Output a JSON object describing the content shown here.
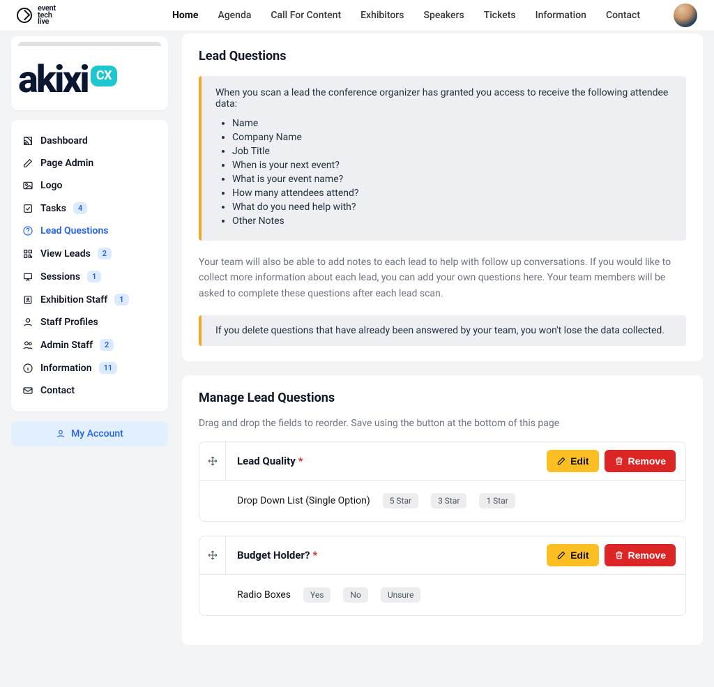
{
  "brand": {
    "l1": "event",
    "l2": "tech",
    "l3": "live"
  },
  "topnav": {
    "items": [
      "Home",
      "Agenda",
      "Call For Content",
      "Exhibitors",
      "Speakers",
      "Tickets",
      "Information",
      "Contact"
    ]
  },
  "company": {
    "name": "akixi",
    "badge": "CX"
  },
  "sidebar": {
    "items": [
      {
        "label": "Dashboard",
        "icon": "feed"
      },
      {
        "label": "Page Admin",
        "icon": "edit"
      },
      {
        "label": "Logo",
        "icon": "image"
      },
      {
        "label": "Tasks",
        "icon": "checkbox",
        "badge": "4"
      },
      {
        "label": "Lead Questions",
        "icon": "help",
        "active": true
      },
      {
        "label": "View Leads",
        "icon": "qr",
        "badge": "2"
      },
      {
        "label": "Sessions",
        "icon": "presentation",
        "badge": "1"
      },
      {
        "label": "Exhibition Staff",
        "icon": "id",
        "badge": "1"
      },
      {
        "label": "Staff Profiles",
        "icon": "user"
      },
      {
        "label": "Admin Staff",
        "icon": "users",
        "badge": "2"
      },
      {
        "label": "Information",
        "icon": "info",
        "badge": "11"
      },
      {
        "label": "Contact",
        "icon": "mail"
      }
    ],
    "my_account": "My Account"
  },
  "lead_questions": {
    "title": "Lead Questions",
    "intro": "When you scan a lead the conference organizer has granted you access to receive the following attendee data:",
    "data_points": [
      "Name",
      "Company Name",
      "Job Title",
      "When is your next event?",
      "What is your event name?",
      "How many attendees attend?",
      "What do you need help with?",
      "Other Notes"
    ],
    "helper": "Your team will also be able to add notes to each lead to help with follow up conversations. If you would like to collect more information about each lead, you can add your own questions here. Your team members will be asked to complete these questions after each lead scan.",
    "warning": "If you delete questions that have already been answered by your team, you won't lose the data collected."
  },
  "manage": {
    "title": "Manage Lead Questions",
    "subtitle": "Drag and drop the fields to reorder. Save using the button at the bottom of this page",
    "edit_label": "Edit",
    "remove_label": "Remove",
    "questions": [
      {
        "title": "Lead Quality",
        "type": "Drop Down List (Single Option)",
        "options": [
          "5 Star",
          "3 Star",
          "1 Star"
        ],
        "required": true
      },
      {
        "title": "Budget Holder?",
        "type": "Radio Boxes",
        "options": [
          "Yes",
          "No",
          "Unsure"
        ],
        "required": true
      }
    ]
  }
}
